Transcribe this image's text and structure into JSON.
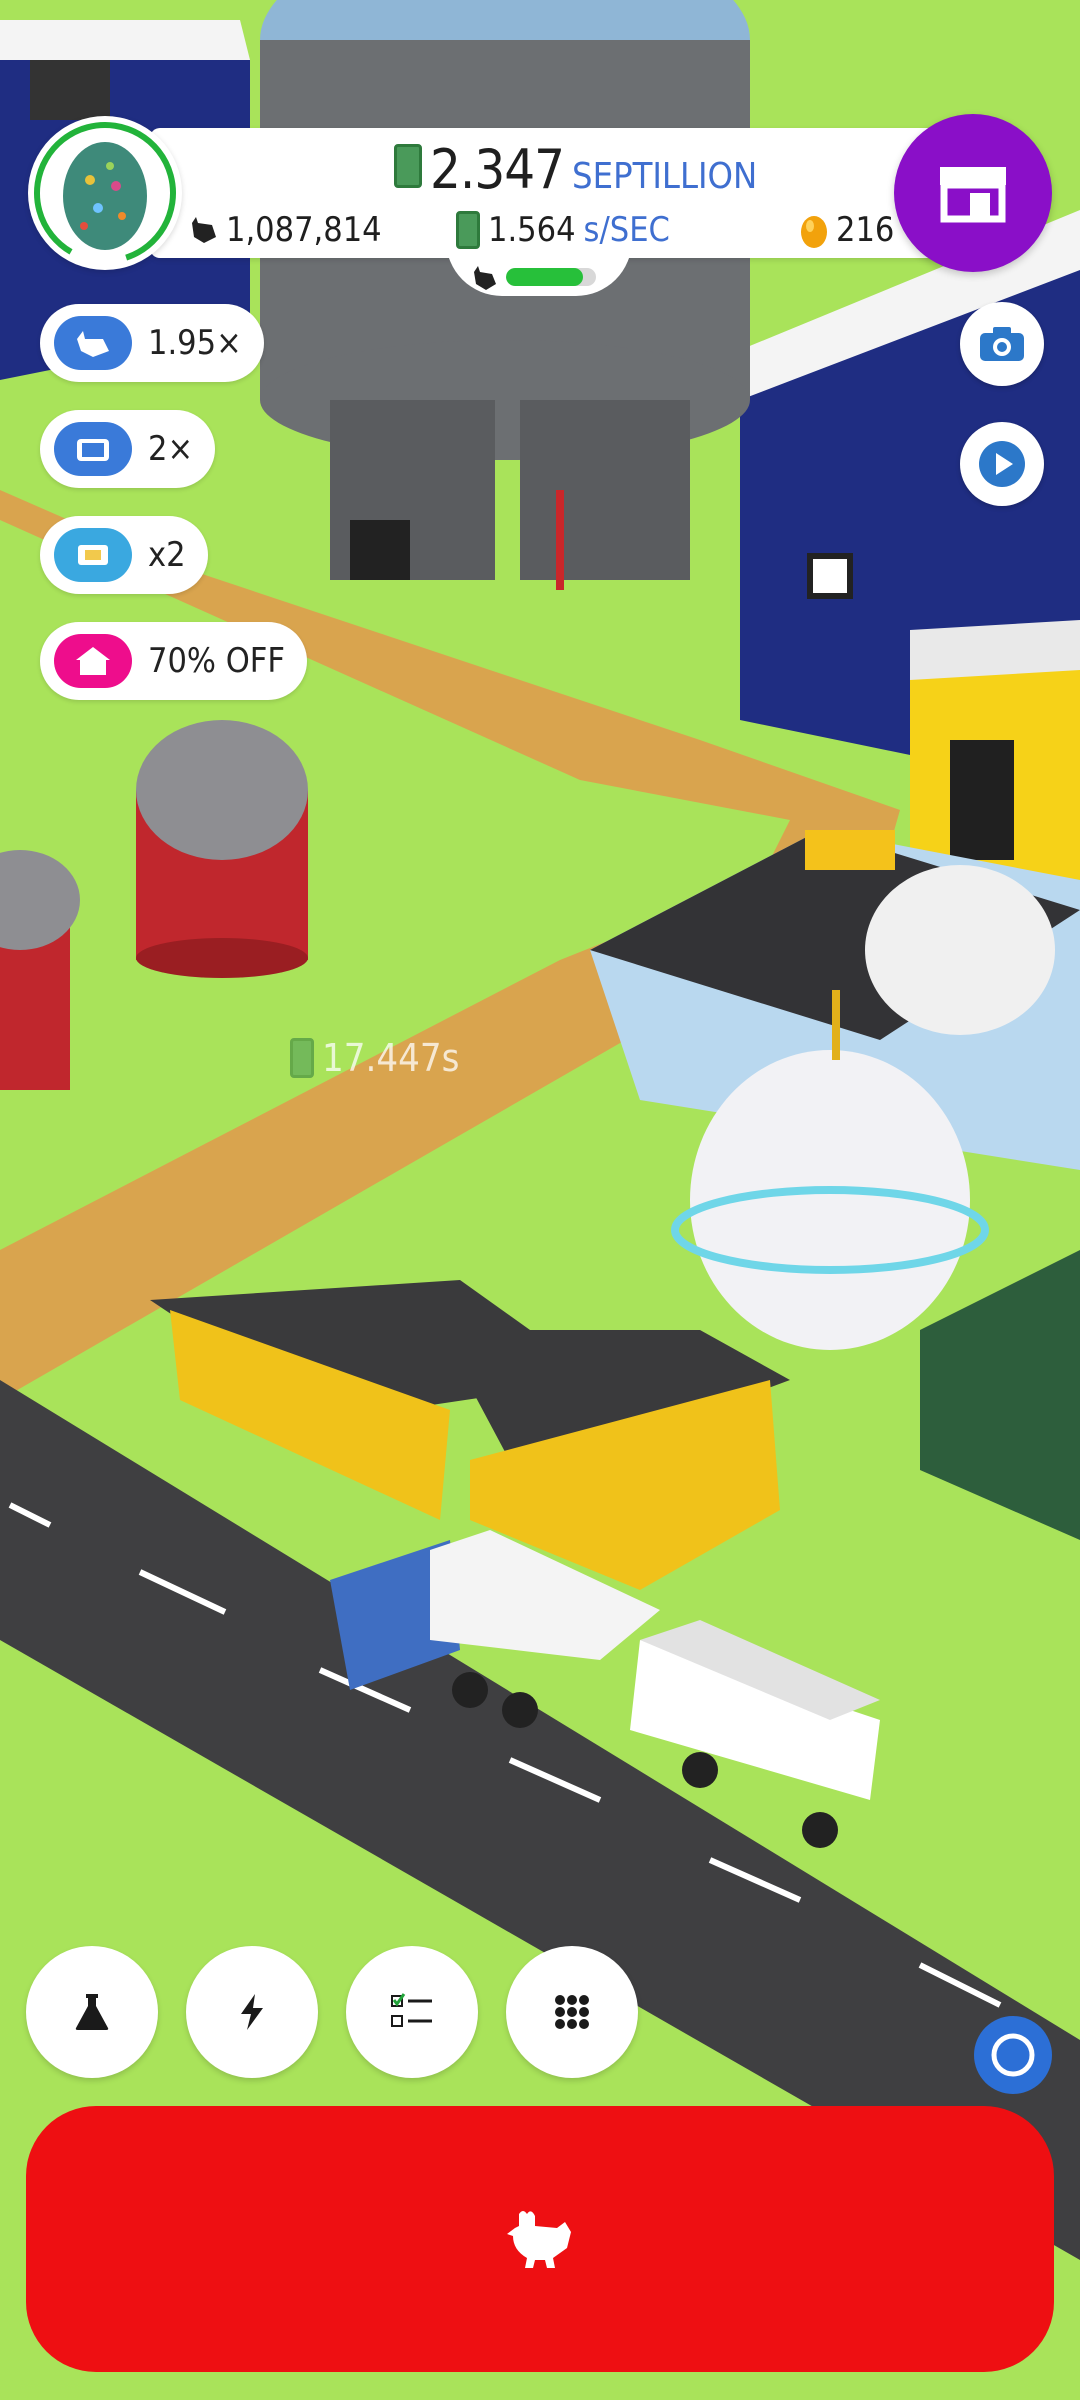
{
  "hud": {
    "money_value": "2.347",
    "money_unit": "SEPTILLION",
    "chicken_count": "1,087,814",
    "rate_value": "1.564",
    "rate_unit": "s/SEC",
    "golden_eggs": "216",
    "population_progress": 0.85
  },
  "boosts": [
    {
      "label": "1.95×",
      "icon": "chicken-icon",
      "color": "#3a7ad9"
    },
    {
      "label": "2×",
      "icon": "tv-icon",
      "color": "#3a7ad9"
    },
    {
      "label": "x2",
      "icon": "game-ticket-icon",
      "color": "#3aa8e0"
    },
    {
      "label": "70% OFF",
      "icon": "home-sale-icon",
      "color": "#ee0d8c"
    }
  ],
  "floating_income": "17.447s",
  "toolbar": [
    "lab-flask-icon",
    "boost-lightning-icon",
    "missions-checklist-icon",
    "menu-grid-icon"
  ],
  "colors": {
    "grass": "#a9e35a",
    "road": "#3f3f41",
    "dirt_path": "#d9a44e",
    "shop": "#8a0fc8",
    "hatch_button": "#ee0f12",
    "accent_blue": "#3f6fd0"
  }
}
